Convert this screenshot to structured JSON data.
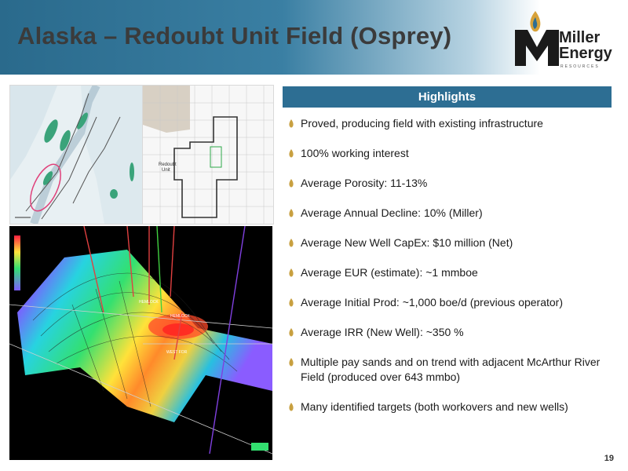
{
  "slide": {
    "title": "Alaska – Redoubt Unit Field (Osprey)",
    "page_number": "19"
  },
  "logo": {
    "line1": "Miller",
    "line2": "Energy",
    "sub": "RESOURCES"
  },
  "map_labels": {
    "redoubt_unit_line1": "Redoubt",
    "redoubt_unit_line2": "Unit",
    "well_hemlock1": "HEMLOCK",
    "well_hemlock2": "HEMLOCK",
    "well_west": "WEST FOR"
  },
  "highlights": {
    "heading": "Highlights",
    "items": [
      "Proved, producing field with existing infrastructure",
      "100% working interest",
      "Average Porosity: 11-13%",
      "Average Annual Decline: 10% (Miller)",
      "Average New Well CapEx: $10 million (Net)",
      "Average EUR (estimate): ~1 mmboe",
      "Average Initial Prod: ~1,000 boe/d (previous operator)",
      "Average IRR (New Well): ~350 %",
      "Multiple pay sands and on trend with adjacent McArthur River Field (produced over 643 mmbo)",
      "Many identified targets (both workovers and new wells)"
    ]
  },
  "colors": {
    "header_blue": "#2d6e93",
    "bullet_gold": "#c8a040",
    "title_gray": "#3b3b3b"
  }
}
